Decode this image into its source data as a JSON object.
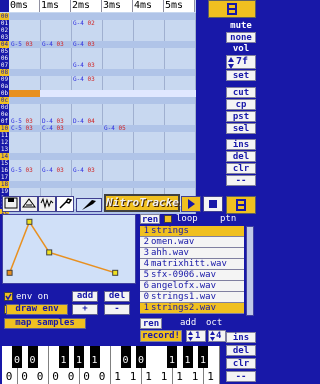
{
  "pattern": {
    "column_headers": [
      "0ms",
      "1ms",
      "2ms",
      "3ms",
      "4ms",
      "5ms"
    ],
    "row_numbers": [
      "00",
      "01",
      "02",
      "03",
      "04",
      "05",
      "06",
      "07",
      "08",
      "09",
      "0a",
      "0b",
      "0c",
      "0d",
      "0e",
      "0f",
      "10",
      "11",
      "12",
      "13",
      "14",
      "15",
      "16",
      "17",
      "18",
      "19",
      "1a",
      "1b",
      "1c",
      "1d",
      "1e",
      "1f"
    ],
    "notes": [
      {
        "row": 1,
        "lane": 2,
        "note": "G-4",
        "vol": "02"
      },
      {
        "row": 4,
        "lane": 0,
        "note": "G-5",
        "vol": "03"
      },
      {
        "row": 4,
        "lane": 1,
        "note": "G-4",
        "vol": "03"
      },
      {
        "row": 4,
        "lane": 2,
        "note": "G-4",
        "vol": "03"
      },
      {
        "row": 7,
        "lane": 2,
        "note": "G-4",
        "vol": "03"
      },
      {
        "row": 9,
        "lane": 2,
        "note": "G-4",
        "vol": "03"
      },
      {
        "row": 15,
        "lane": 0,
        "note": "G-5",
        "vol": "03"
      },
      {
        "row": 15,
        "lane": 1,
        "note": "D-4",
        "vol": "03"
      },
      {
        "row": 15,
        "lane": 2,
        "note": "D-4",
        "vol": "04"
      },
      {
        "row": 16,
        "lane": 0,
        "note": "C-5",
        "vol": "03"
      },
      {
        "row": 16,
        "lane": 1,
        "note": "C-4",
        "vol": "03"
      },
      {
        "row": 16,
        "lane": 3,
        "note": "G-4",
        "vol": "05"
      },
      {
        "row": 22,
        "lane": 0,
        "note": "G-5",
        "vol": "03"
      },
      {
        "row": 22,
        "lane": 1,
        "note": "G-4",
        "vol": "03"
      },
      {
        "row": 22,
        "lane": 2,
        "note": "G-4",
        "vol": "03"
      }
    ]
  },
  "right_panel": {
    "mute_label": "mute",
    "none_label": "none",
    "vol_label": "vol",
    "vol_value": "7f",
    "set_label": "set",
    "cut_label": "cut",
    "cp_label": "cp",
    "pst_label": "pst",
    "sel_label": "sel",
    "ins_label": "ins",
    "del_label": "del",
    "clr_label": "clr",
    "dash_label": "--"
  },
  "logo_text": "NitroTracker",
  "play_icon": "play-icon",
  "stop_icon": "stop-icon",
  "tabs": [
    "disk-icon",
    "instrument-icon",
    "sample-icon",
    "wrench-icon"
  ],
  "envelope": {
    "points": [
      [
        0.05,
        0.85
      ],
      [
        0.2,
        0.1
      ],
      [
        0.35,
        0.55
      ],
      [
        0.85,
        0.85
      ]
    ],
    "env_on_label": "env on",
    "add_label": "add",
    "del_label": "del",
    "draw_env_label": "draw env",
    "plus_label": "+",
    "minus_label": "-",
    "map_samples_label": "map samples"
  },
  "samples": {
    "ren_label": "ren",
    "loop_label": "loop",
    "ptn_label": "ptn",
    "items": [
      {
        "num": "1",
        "name": "strings",
        "selected": true
      },
      {
        "num": "2",
        "name": "omen.wav",
        "selected": false
      },
      {
        "num": "3",
        "name": "ahh.wav",
        "selected": false
      },
      {
        "num": "4",
        "name": "matrixhitt.wav",
        "selected": false
      },
      {
        "num": "5",
        "name": "sfx-0906.wav",
        "selected": false
      },
      {
        "num": "6",
        "name": "angelofx.wav",
        "selected": false
      },
      {
        "num": "0",
        "name": "strings1.wav",
        "selected": false
      },
      {
        "num": "1",
        "name": "strings2.wav",
        "selected": true
      }
    ]
  },
  "bottom": {
    "ren_label": "ren",
    "add_label": "add",
    "oct_label": "oct",
    "record_label": "record!",
    "add_value": "1",
    "oct_value": "4",
    "ins_label": "ins",
    "del_label": "del",
    "clr_label": "clr",
    "dash_label": "--"
  },
  "keyboard": {
    "white_labels": [
      "0",
      "0",
      "0",
      "0",
      "0",
      "0",
      "0",
      "1",
      "1",
      "1",
      "1",
      "1",
      "1",
      "1"
    ],
    "black_labels": [
      "0",
      "0",
      "1",
      "1",
      "1"
    ]
  }
}
